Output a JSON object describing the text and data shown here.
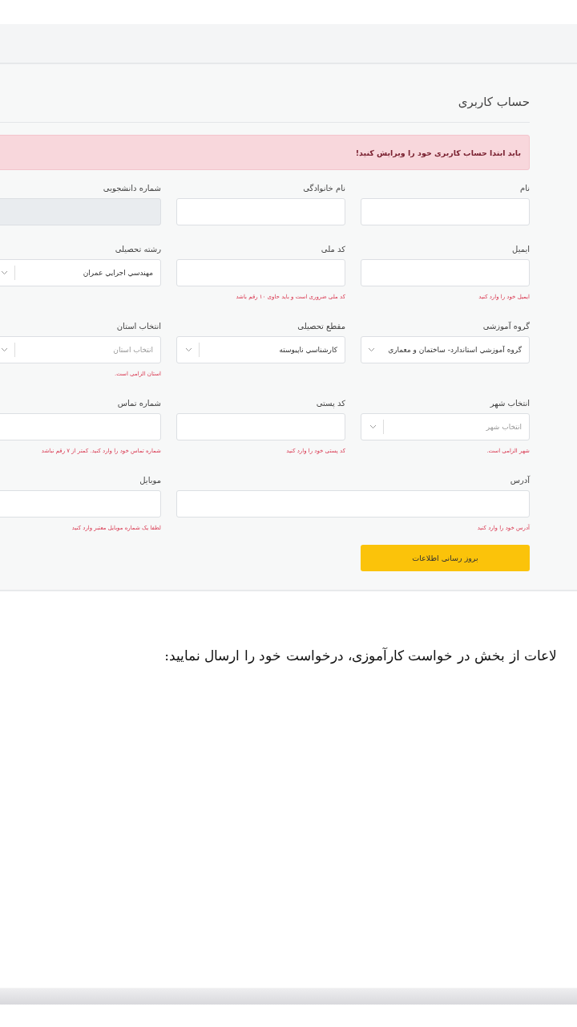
{
  "title": "حساب کاربری",
  "alert": "باید ابتدا حساب کاربری خود را ویرایش کنید!",
  "rows": [
    [
      {
        "label": "نام",
        "kind": "input",
        "disabled": false
      },
      {
        "label": "نام خانوادگی",
        "kind": "input",
        "disabled": false
      },
      {
        "label": "شماره دانشجویی",
        "kind": "input",
        "disabled": true
      }
    ],
    [
      {
        "label": "ایمیل",
        "kind": "input",
        "disabled": false,
        "error": "ایمیل خود را وارد کنید"
      },
      {
        "label": "کد ملی",
        "kind": "input",
        "disabled": false,
        "error": "کد ملی ضروری است و باید حاوی ۱۰ رقم باشد"
      },
      {
        "label": "رشته تحصیلی",
        "kind": "select",
        "disabled": false,
        "value": "مهندسي اجرايي عمران"
      }
    ],
    [
      {
        "label": "گروه آموزشی",
        "kind": "select",
        "disabled": false,
        "value": "گروه آموزشي استاندارد- ساختمان و معماري"
      },
      {
        "label": "مقطع تحصیلی",
        "kind": "select",
        "disabled": false,
        "value": "کارشناسي ناپيوسته"
      },
      {
        "label": "انتخاب استان",
        "kind": "select",
        "disabled": false,
        "placeholder": "انتخاب استان",
        "error": "استان الزامی است."
      }
    ],
    [
      {
        "label": "انتخاب شهر",
        "kind": "select",
        "disabled": false,
        "placeholder": "انتخاب شهر",
        "error": "شهر الزامی است."
      },
      {
        "label": "کد پستی",
        "kind": "input",
        "disabled": false,
        "error": "کد پستی خود را وارد کنید"
      },
      {
        "label": "شماره تماس",
        "kind": "input",
        "disabled": false,
        "error": "شماره تماس خود را وارد کنید. کمتر از ۷ رقم نباشد"
      }
    ],
    [
      {
        "label": "آدرس",
        "kind": "input",
        "disabled": false,
        "error": "آدرس خود را وارد کنید"
      },
      {
        "label": "موبایل",
        "kind": "input",
        "disabled": false,
        "error": "لطفا یک شماره موبایل معتبر وارد کنید"
      }
    ]
  ],
  "submit": "بروز رسانی اطلاعات",
  "paragraph": "لاعات از بخش در خواست کارآموزی، درخواست خود را ارسال نمایید:"
}
